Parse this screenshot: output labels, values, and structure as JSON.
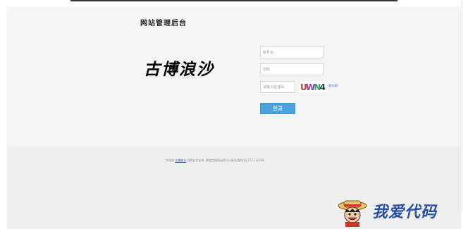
{
  "header": {
    "admin_title": "网站管理后台",
    "logo_text": "古博浪沙"
  },
  "form": {
    "username_placeholder": "帐号名",
    "password_placeholder": "密码",
    "captcha_placeholder": "请输入验证码",
    "captcha_text": "UWN4",
    "refresh_link": "看不清?",
    "login_button": "登录"
  },
  "footer": {
    "prefix": "本站由",
    "brand": "古博浪沙",
    "support": "提供技术支持",
    "contact": "需要定制网站的可以联系我的QQ 157312308"
  },
  "watermark": {
    "text": "我爱代码"
  },
  "colors": {
    "button": "#4aa3df",
    "link": "#3377cc",
    "watermark": "#2650a8"
  }
}
